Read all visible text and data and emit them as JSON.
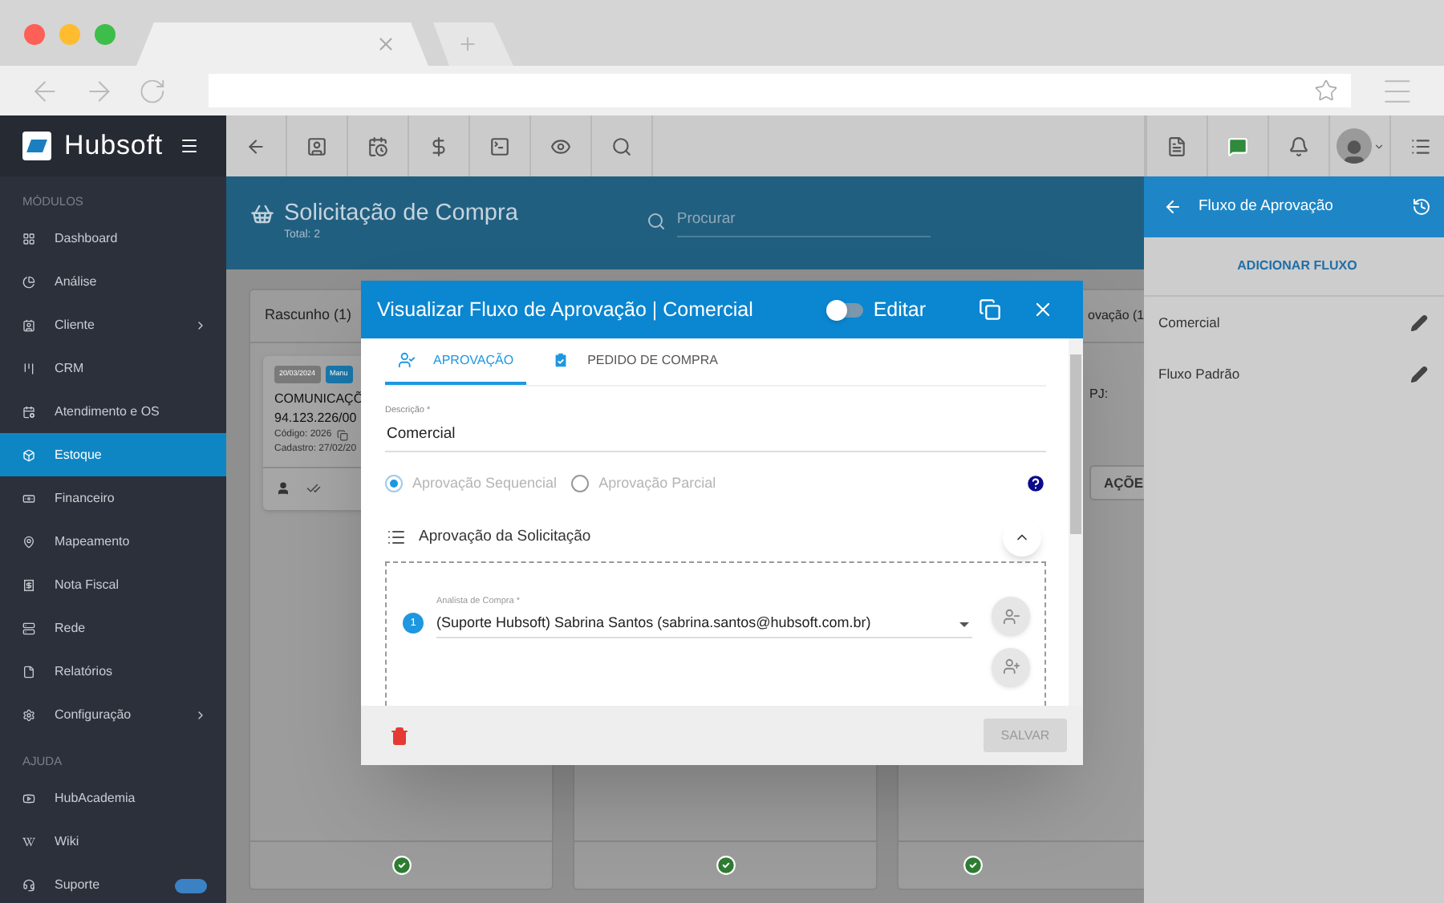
{
  "sidebar": {
    "logo": "Hubsoft",
    "sections": [
      {
        "label": "MÓDULOS",
        "items": [
          {
            "label": "Dashboard",
            "selected": false,
            "has_submenu": false
          },
          {
            "label": "Análise",
            "selected": false,
            "has_submenu": false
          },
          {
            "label": "Cliente",
            "selected": false,
            "has_submenu": true
          },
          {
            "label": "CRM",
            "selected": false,
            "has_submenu": false
          },
          {
            "label": "Atendimento e OS",
            "selected": false,
            "has_submenu": false
          },
          {
            "label": "Estoque",
            "selected": true,
            "has_submenu": false
          },
          {
            "label": "Financeiro",
            "selected": false,
            "has_submenu": false
          },
          {
            "label": "Mapeamento",
            "selected": false,
            "has_submenu": false
          },
          {
            "label": "Nota Fiscal",
            "selected": false,
            "has_submenu": false
          },
          {
            "label": "Rede",
            "selected": false,
            "has_submenu": false
          },
          {
            "label": "Relatórios",
            "selected": false,
            "has_submenu": false
          },
          {
            "label": "Configuração",
            "selected": false,
            "has_submenu": true
          }
        ]
      },
      {
        "label": "AJUDA",
        "items": [
          {
            "label": "HubAcademia",
            "selected": false,
            "has_submenu": false
          },
          {
            "label": "Wiki",
            "selected": false,
            "has_submenu": false
          },
          {
            "label": "Suporte",
            "selected": false,
            "has_submenu": false
          }
        ]
      }
    ]
  },
  "page": {
    "title": "Solicitação de Compra",
    "subtitle": "Total: 2",
    "search": {
      "placeholder": "Procurar"
    }
  },
  "kanban": {
    "columns": [
      {
        "title": "Rascunho (1)",
        "cards": [
          {
            "badges": [
              {
                "text": "20/03/2024",
                "color": "#7a7a7a"
              },
              {
                "text": "Manu",
                "color": "#1a78ad"
              }
            ],
            "title": "COMUNICAÇÕ",
            "document": "94.123.226/00",
            "code": "Código: 2026",
            "created": "Cadastro: 27/02/20"
          }
        ]
      },
      {},
      {
        "title": "ovação (1",
        "cards": [
          {
            "fragment": "PJ:",
            "action": "AÇÕE"
          }
        ]
      }
    ]
  },
  "modal": {
    "title": "Visualizar Fluxo de Aprovação | Comercial",
    "edit_toggle": {
      "label": "Editar",
      "on": false
    },
    "tabs": [
      {
        "label": "APROVAÇÃO",
        "selected": true
      },
      {
        "label": "PEDIDO DE COMPRA",
        "selected": false
      }
    ],
    "description": {
      "label": "Descrição *",
      "value": "Comercial"
    },
    "approval_modes": [
      {
        "label": "Aprovação Sequencial",
        "selected": true
      },
      {
        "label": "Aprovação Parcial",
        "selected": false
      }
    ],
    "section": {
      "title": "Aprovação da Solicitação",
      "expanded": true
    },
    "steps": [
      {
        "number": "1",
        "label": "Analista de Compra *",
        "value": "(Suporte Hubsoft) Sabrina Santos (sabrina.santos@hubsoft.com.br)"
      }
    ],
    "save_button": {
      "label": "SALVAR",
      "disabled": true
    }
  },
  "right_panel": {
    "title": "Fluxo de Aprovação",
    "add_button": "ADICIONAR FLUXO",
    "flows": [
      "Comercial",
      "Fluxo Padrão"
    ]
  }
}
